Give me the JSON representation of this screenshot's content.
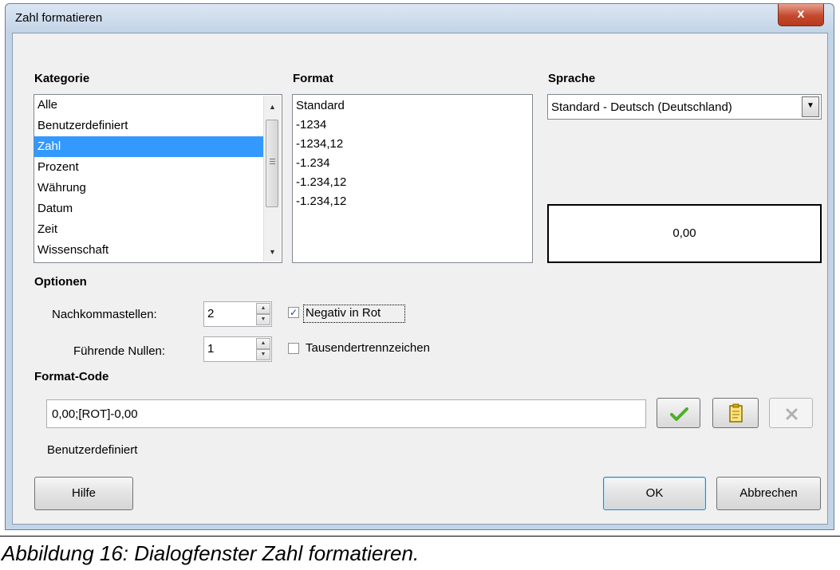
{
  "window": {
    "title": "Zahl formatieren",
    "close_glyph": "x"
  },
  "kategorie": {
    "heading": "Kategorie",
    "items": [
      "Alle",
      "Benutzerdefiniert",
      "Zahl",
      "Prozent",
      "Währung",
      "Datum",
      "Zeit",
      "Wissenschaft"
    ],
    "selected": "Zahl"
  },
  "format": {
    "heading": "Format",
    "items": [
      "Standard",
      "-1234",
      "-1234,12",
      "-1.234",
      "-1.234,12",
      "-1.234,12"
    ]
  },
  "sprache": {
    "heading": "Sprache",
    "selected": "Standard - Deutsch (Deutschland)"
  },
  "preview": {
    "value": "0,00"
  },
  "optionen": {
    "heading": "Optionen",
    "nachkommastellen_label": "Nachkommastellen:",
    "nachkommastellen_value": "2",
    "fuehrende_nullen_label": "Führende Nullen:",
    "fuehrende_nullen_value": "1",
    "negativ_in_rot_label": "Negativ in Rot",
    "negativ_in_rot_checked": true,
    "tausender_label": "Tausendertrennzeichen",
    "tausender_checked": false
  },
  "format_code": {
    "heading": "Format-Code",
    "value": "0,00;[ROT]-0,00",
    "description": "Benutzerdefiniert"
  },
  "buttons": {
    "hilfe": "Hilfe",
    "ok": "OK",
    "abbrechen": "Abbrechen"
  },
  "caption": "Abbildung 16: Dialogfenster Zahl formatieren.",
  "icons": {
    "accept": "checkmark-icon",
    "comment": "note-edit-icon",
    "delete": "delete-x-icon"
  },
  "colors": {
    "selection": "#3399ff",
    "accept_icon": "#4caf2a"
  }
}
